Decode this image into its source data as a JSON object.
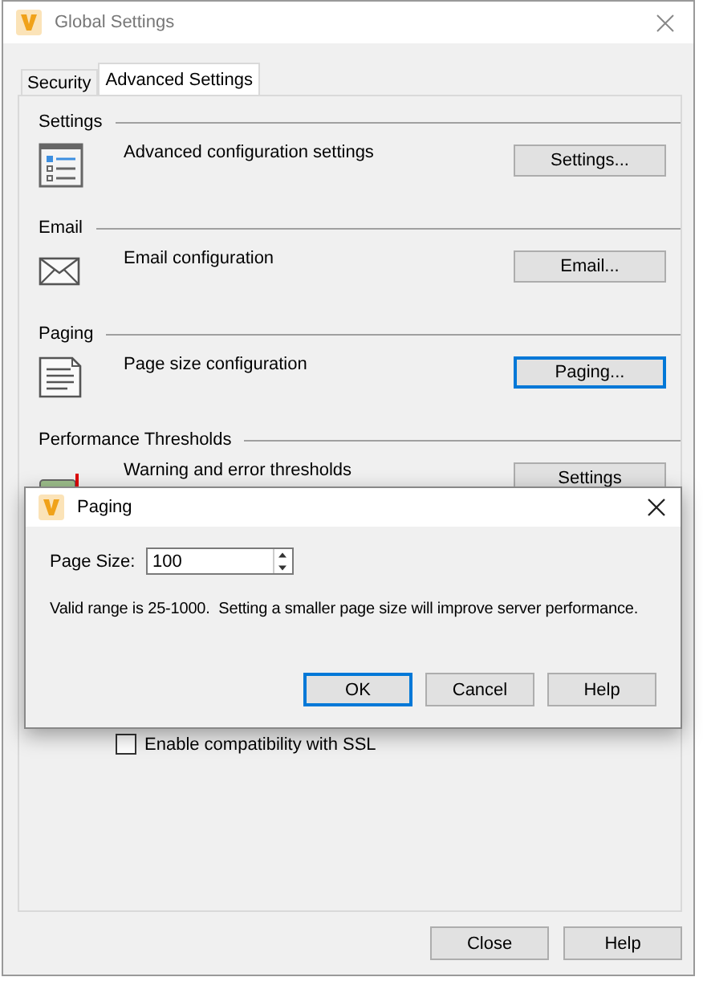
{
  "window": {
    "title": "Global Settings"
  },
  "tabs": [
    {
      "label": "Security",
      "selected": false
    },
    {
      "label": "Advanced Settings",
      "selected": true
    }
  ],
  "sections": [
    {
      "heading": "Settings",
      "kind": "list",
      "description": "Advanced configuration settings",
      "button": "Settings...",
      "focused": false
    },
    {
      "heading": "Email",
      "kind": "mail",
      "description": "Email configuration",
      "button": "Email...",
      "focused": false
    },
    {
      "heading": "Paging",
      "kind": "page",
      "description": "Page size configuration",
      "button": "Paging...",
      "focused": true
    },
    {
      "heading": "Performance Thresholds",
      "kind": "chart",
      "description": "Warning and error thresholds",
      "button": "Settings",
      "focused": false
    }
  ],
  "checkbox": {
    "label": "Enable compatibility with SSL",
    "checked": false
  },
  "buttons": [
    "Close",
    "Help"
  ],
  "dialog": {
    "title": "Paging",
    "field_label": "Page Size:",
    "value": "100",
    "message": "Valid range is 25-1000.  Setting a smaller page size will improve server performance.",
    "buttons": [
      {
        "label": "OK",
        "default": true
      },
      {
        "label": "Cancel",
        "default": false
      },
      {
        "label": "Help",
        "default": false
      }
    ]
  }
}
